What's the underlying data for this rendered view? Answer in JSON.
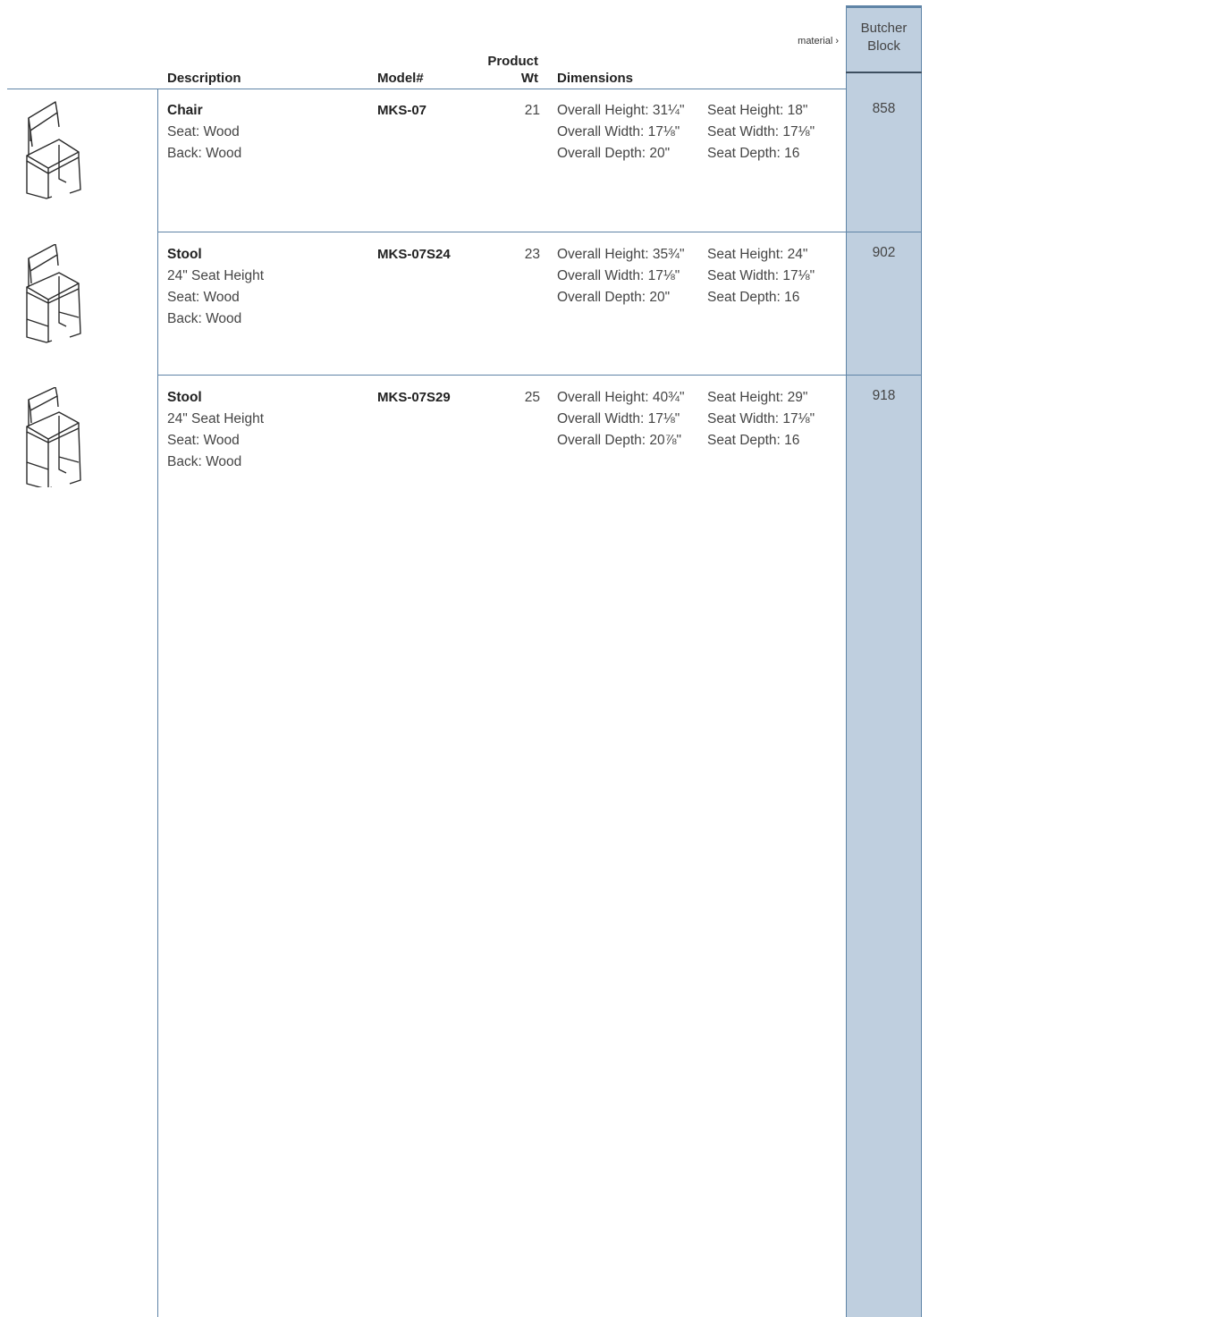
{
  "header": {
    "material_label": "material ›",
    "description": "Description",
    "model": "Model#",
    "product_wt_line1": "Product",
    "product_wt_line2": "Wt",
    "dimensions": "Dimensions",
    "price_column_line1": "Butcher",
    "price_column_line2": "Block"
  },
  "rows": [
    {
      "icon": "chair-icon",
      "name": "Chair",
      "details": [
        "Seat: Wood",
        "Back: Wood"
      ],
      "model": "MKS-07",
      "weight": "21",
      "dims_overall": [
        "Overall Height: 31¼\"",
        "Overall Width: 17⅛\"",
        "Overall Depth: 20\""
      ],
      "dims_seat": [
        "Seat Height: 18\"",
        "Seat Width: 17⅛\"",
        "Seat Depth: 16"
      ],
      "price": "858"
    },
    {
      "icon": "stool-icon",
      "name": "Stool",
      "details": [
        "24\" Seat Height",
        "Seat: Wood",
        "Back: Wood"
      ],
      "model": "MKS-07S24",
      "weight": "23",
      "dims_overall": [
        "Overall Height: 35¾\"",
        "Overall Width: 17⅛\"",
        "Overall Depth: 20\""
      ],
      "dims_seat": [
        "Seat Height: 24\"",
        "Seat Width: 17⅛\"",
        "Seat Depth: 16"
      ],
      "price": "902"
    },
    {
      "icon": "stool-icon",
      "name": "Stool",
      "details": [
        "24\" Seat Height",
        "Seat: Wood",
        "Back: Wood"
      ],
      "model": "MKS-07S29",
      "weight": "25",
      "dims_overall": [
        "Overall Height: 40¾\"",
        "Overall Width: 17⅛\"",
        "Overall Depth: 20⅞\""
      ],
      "dims_seat": [
        "Seat Height: 29\"",
        "Seat Width: 17⅛\"",
        "Seat Depth: 16"
      ],
      "price": "918"
    }
  ]
}
